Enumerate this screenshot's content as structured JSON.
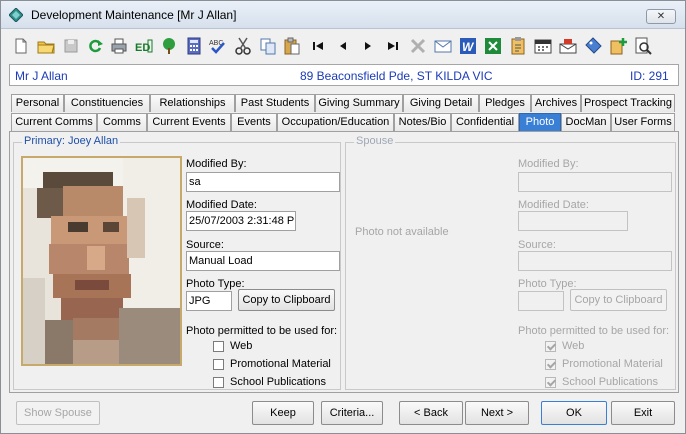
{
  "window": {
    "title": "Development Maintenance  [Mr J Allan]",
    "close_label": "✕"
  },
  "toolbar": {
    "icons": [
      "new-icon",
      "open-icon",
      "save-icon",
      "refresh-icon",
      "print-icon",
      "ed-icon",
      "tree-icon",
      "calculator-icon",
      "spellcheck-icon",
      "cut-icon",
      "copy-icon",
      "paste-icon",
      "first-icon",
      "previous-icon",
      "next-icon",
      "last-icon",
      "delete-icon",
      "email-icon",
      "word-icon",
      "excel-icon",
      "clipboard-icon",
      "calendar-icon",
      "mail-merge-icon",
      "tag-icon",
      "add-icon",
      "preview-icon"
    ],
    "ed_label": "ED"
  },
  "infobar": {
    "name": "Mr J Allan",
    "address": "89 Beaconsfield Pde, ST KILDA VIC",
    "id": "ID: 291"
  },
  "tabs": {
    "row1": [
      "Personal",
      "Constituencies",
      "Relationships",
      "Past Students",
      "Giving Summary",
      "Giving Detail",
      "Pledges",
      "Archives",
      "Prospect Tracking"
    ],
    "row2": [
      "Current Comms",
      "Comms",
      "Current Events",
      "Events",
      "Occupation/Education",
      "Notes/Bio",
      "Confidential",
      "Photo",
      "DocMan",
      "User Forms"
    ],
    "active": "Photo"
  },
  "primary": {
    "title": "Primary: Joey Allan",
    "modified_by_label": "Modified By:",
    "modified_by": "sa",
    "modified_date_label": "Modified Date:",
    "modified_date": "25/07/2003 2:31:48 P",
    "source_label": "Source:",
    "source": "Manual Load",
    "photo_type_label": "Photo Type:",
    "photo_type": "JPG",
    "copy_button": "Copy to Clipboard",
    "permitted_label": "Photo permitted to be used for:",
    "uses": [
      {
        "label": "Web",
        "checked": false
      },
      {
        "label": "Promotional Material",
        "checked": false
      },
      {
        "label": "School Publications",
        "checked": false
      }
    ]
  },
  "spouse": {
    "title": "Spouse",
    "not_available": "Photo not available",
    "modified_by_label": "Modified By:",
    "modified_date_label": "Modified Date:",
    "source_label": "Source:",
    "photo_type_label": "Photo Type:",
    "copy_button": "Copy to Clipboard",
    "permitted_label": "Photo permitted to be used for:",
    "uses": [
      {
        "label": "Web",
        "checked": true
      },
      {
        "label": "Promotional Material",
        "checked": true
      },
      {
        "label": "School Publications",
        "checked": true
      }
    ]
  },
  "buttons": {
    "show_spouse": "Show Spouse",
    "keep": "Keep",
    "criteria": "Criteria...",
    "back": "< Back",
    "next": "Next >",
    "ok": "OK",
    "exit": "Exit"
  },
  "colors": {
    "accent": "#3a7fd6",
    "infobar_text": "#1c3bb8",
    "group_title": "#1f4fa8"
  }
}
